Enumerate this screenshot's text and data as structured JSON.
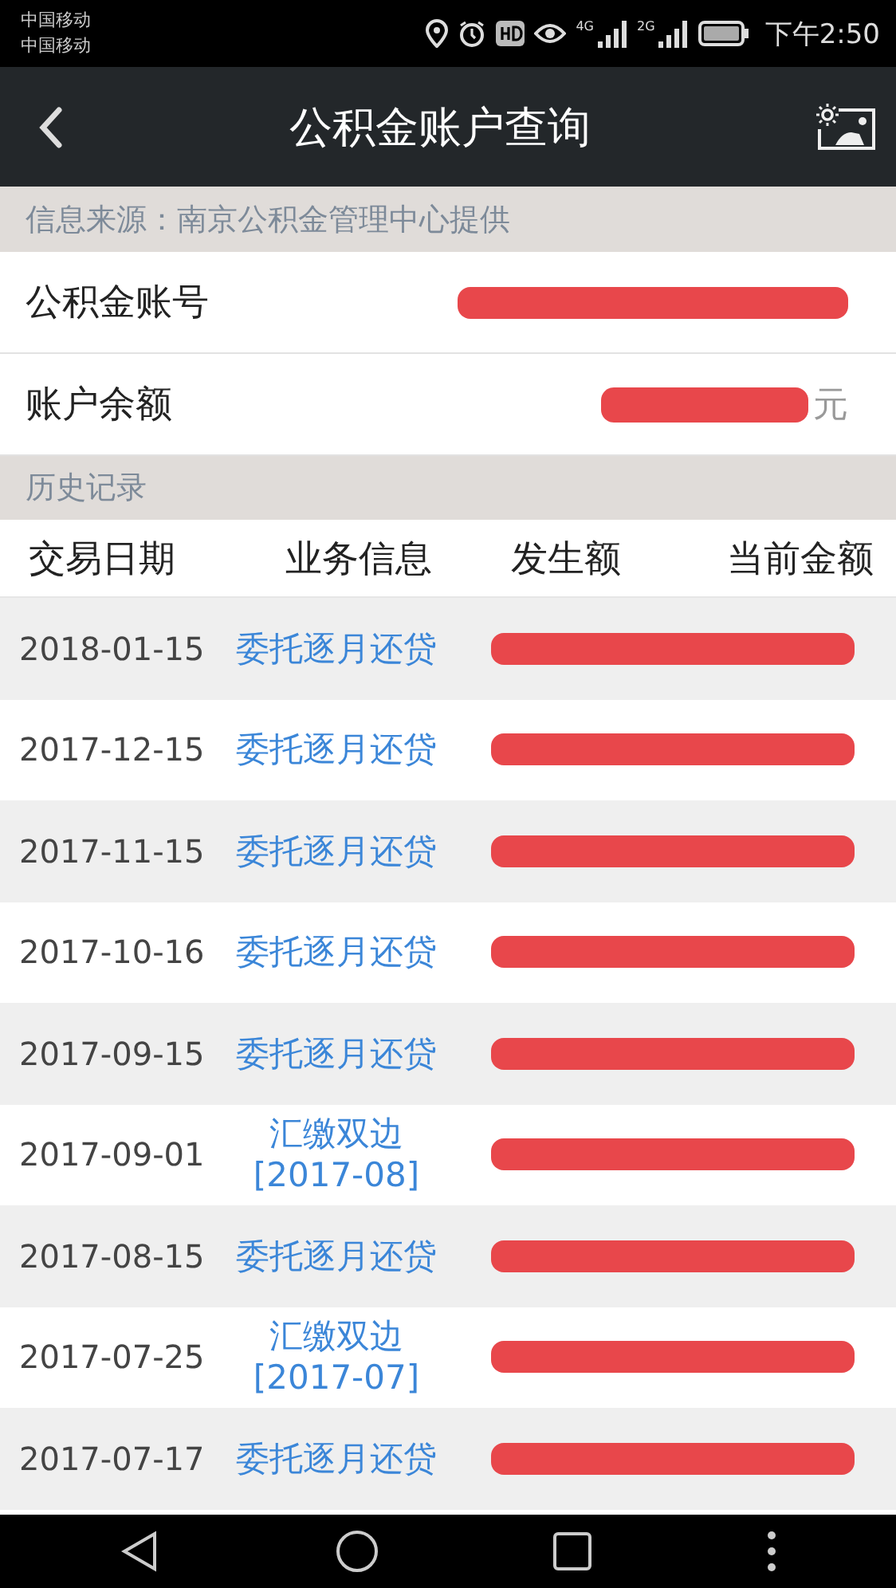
{
  "status_bar": {
    "carriers": [
      "中国移动",
      "中国移动"
    ],
    "network_labels": [
      "4G",
      "2G"
    ],
    "time": "下午2:50"
  },
  "header": {
    "title": "公积金账户查询"
  },
  "source_note": "信息来源：南京公积金管理中心提供",
  "account": [
    {
      "label": "公积金账号",
      "redacted": true
    },
    {
      "label": "账户余额",
      "unit": "元",
      "redacted": true
    }
  ],
  "history": {
    "title": "历史记录",
    "columns": [
      "交易日期",
      "业务信息",
      "发生额",
      "当前金额"
    ],
    "rows": [
      {
        "date": "2018-01-15",
        "info": [
          "委托逐月还贷"
        ],
        "redacted": true
      },
      {
        "date": "2017-12-15",
        "info": [
          "委托逐月还贷"
        ],
        "redacted": true
      },
      {
        "date": "2017-11-15",
        "info": [
          "委托逐月还贷"
        ],
        "redacted": true
      },
      {
        "date": "2017-10-16",
        "info": [
          "委托逐月还贷"
        ],
        "redacted": true
      },
      {
        "date": "2017-09-15",
        "info": [
          "委托逐月还贷"
        ],
        "redacted": true
      },
      {
        "date": "2017-09-01",
        "info": [
          "汇缴双边",
          "[2017-08]"
        ],
        "redacted": true
      },
      {
        "date": "2017-08-15",
        "info": [
          "委托逐月还贷"
        ],
        "redacted": true
      },
      {
        "date": "2017-07-25",
        "info": [
          "汇缴双边",
          "[2017-07]"
        ],
        "redacted": true
      },
      {
        "date": "2017-07-17",
        "info": [
          "委托逐月还贷"
        ],
        "redacted": true
      }
    ]
  }
}
